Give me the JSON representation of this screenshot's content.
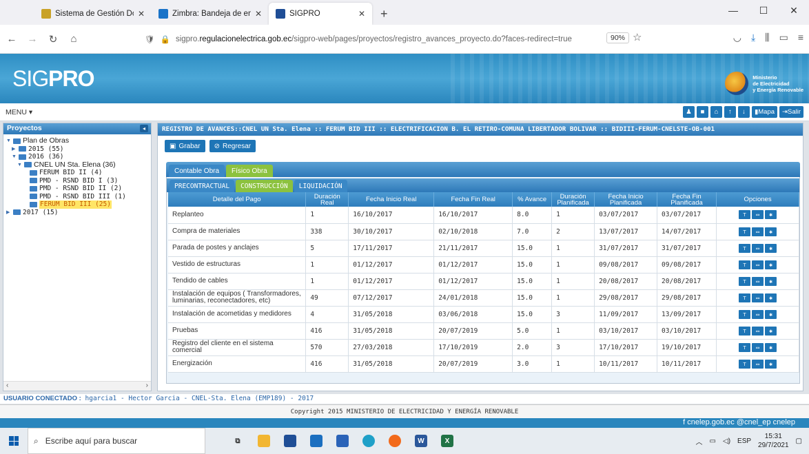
{
  "browser": {
    "tabs": [
      {
        "title": "Sistema de Gestión Documenta",
        "close": "✕"
      },
      {
        "title": "Zimbra: Bandeja de entrada",
        "close": "✕"
      },
      {
        "title": "SIGPRO",
        "close": "✕"
      }
    ],
    "new_tab": "+",
    "url_prefix": "sigpro.",
    "url_domain": "regulacionelectrica.gob.ec",
    "url_path": "/sigpro-web/pages/proyectos/registro_avances_proyecto.do?faces-redirect=true",
    "zoom": "90%"
  },
  "app": {
    "logo_sig": "SIG",
    "logo_pro": "PRO",
    "ministry_line1": "Ministerio",
    "ministry_line2": "de Electricidad",
    "ministry_line3": "y Energía Renovable",
    "menu_label": "MENU ▾",
    "top_buttons": {
      "mapa": "Mapa",
      "salir": "Salir"
    }
  },
  "sidebar": {
    "title": "Proyectos",
    "nodes": [
      {
        "label": "Plan de Obras"
      },
      {
        "label": "2015 (55)"
      },
      {
        "label": "2016 (36)"
      },
      {
        "label": "CNEL UN Sta. Elena (36)"
      },
      {
        "label": "FERUM BID II (4)"
      },
      {
        "label": "PMD - RSND BID I (3)"
      },
      {
        "label": "PMD - RSND BID II (2)"
      },
      {
        "label": "PMD - RSND BID III (1)"
      },
      {
        "label": "FERUM BID III (25)"
      },
      {
        "label": "2017 (15)"
      }
    ]
  },
  "main": {
    "title": "REGISTRO DE AVANCES::CNEL UN Sta. Elena :: FERUM BID III :: ELECTRIFICACION B. EL RETIRO-COMUNA LIBERTADOR BOLIVAR :: BIDIII-FERUM-CNELSTE-OB-001",
    "grabar": "Grabar",
    "regresar": "Regresar",
    "tabs": [
      "Contable Obra",
      "Físico Obra"
    ],
    "subtabs": [
      "PRECONTRACTUAL",
      "CONSTRUCCIÓN",
      "LIQUIDACIÓN"
    ],
    "columns": [
      "Detalle del Pago",
      "Duración Real",
      "Fecha Inicio Real",
      "Fecha Fin Real",
      "% Avance",
      "Duración Planificada",
      "Fecha Inicio Planificada",
      "Fecha Fin Planificada",
      "Opciones"
    ],
    "rows": [
      [
        "Replanteo",
        "1",
        "16/10/2017",
        "16/10/2017",
        "8.0",
        "1",
        "03/07/2017",
        "03/07/2017"
      ],
      [
        "Compra de materiales",
        "338",
        "30/10/2017",
        "02/10/2018",
        "7.0",
        "2",
        "13/07/2017",
        "14/07/2017"
      ],
      [
        "Parada de postes y anclajes",
        "5",
        "17/11/2017",
        "21/11/2017",
        "15.0",
        "1",
        "31/07/2017",
        "31/07/2017"
      ],
      [
        "Vestido de estructuras",
        "1",
        "01/12/2017",
        "01/12/2017",
        "15.0",
        "1",
        "09/08/2017",
        "09/08/2017"
      ],
      [
        "Tendido de cables",
        "1",
        "01/12/2017",
        "01/12/2017",
        "15.0",
        "1",
        "20/08/2017",
        "20/08/2017"
      ],
      [
        "Instalación de equipos ( Transformadores, luminarias, reconectadores, etc)",
        "49",
        "07/12/2017",
        "24/01/2018",
        "15.0",
        "1",
        "29/08/2017",
        "29/08/2017"
      ],
      [
        "Instalación de acometidas y medidores",
        "4",
        "31/05/2018",
        "03/06/2018",
        "15.0",
        "3",
        "11/09/2017",
        "13/09/2017"
      ],
      [
        "Pruebas",
        "416",
        "31/05/2018",
        "20/07/2019",
        "5.0",
        "1",
        "03/10/2017",
        "03/10/2017"
      ],
      [
        "Registro del cliente en el sistema comercial",
        "570",
        "27/03/2018",
        "17/10/2019",
        "2.0",
        "3",
        "17/10/2017",
        "19/10/2017"
      ],
      [
        "Energización",
        "416",
        "31/05/2018",
        "20/07/2019",
        "3.0",
        "1",
        "10/11/2017",
        "10/11/2017"
      ]
    ]
  },
  "status": {
    "label": "USUARIO CONECTADO :",
    "value": "hgarcia1 - Hector Garcia - CNEL-Sta. Elena (EMP189) - 2017"
  },
  "footer": "Copyright 2015 MINISTERIO DE ELECTRICIDAD Y ENERGÍA RENOVABLE",
  "strip_text": "f cnelep.gob.ec  @cnel_ep  cnelep",
  "taskbar": {
    "search_placeholder": "Escribe aquí para buscar",
    "lang": "ESP",
    "time": "15:31",
    "date": "29/7/2021"
  },
  "colors": {
    "accent": "#1e75b6",
    "active_tab": "#8cc23f",
    "selected": "#ffe566"
  }
}
